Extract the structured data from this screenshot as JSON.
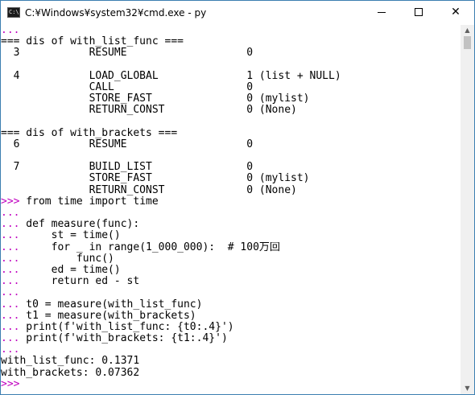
{
  "window": {
    "title": "C:¥Windows¥system32¥cmd.exe - py",
    "icon_label": "C:\\",
    "minimize_glyph": "",
    "maximize_glyph": "",
    "close_glyph": "✕",
    "colors": {
      "prompt_ps1": "#c000c0",
      "prompt_ps2": "#c000c0",
      "text": "#000000",
      "background": "#ffffff"
    }
  },
  "scrollbar": {
    "up_arrow": "▲",
    "down_arrow": "▼"
  },
  "console": {
    "lines": [
      {
        "prompt": "...",
        "text": ""
      },
      {
        "prompt": "",
        "text": "=== dis of with_list_func ==="
      },
      {
        "prompt": "",
        "text": "  3           RESUME                   0"
      },
      {
        "prompt": "",
        "text": ""
      },
      {
        "prompt": "",
        "text": "  4           LOAD_GLOBAL              1 (list + NULL)"
      },
      {
        "prompt": "",
        "text": "              CALL                     0"
      },
      {
        "prompt": "",
        "text": "              STORE_FAST               0 (mylist)"
      },
      {
        "prompt": "",
        "text": "              RETURN_CONST             0 (None)"
      },
      {
        "prompt": "",
        "text": ""
      },
      {
        "prompt": "",
        "text": "=== dis of with_brackets ==="
      },
      {
        "prompt": "",
        "text": "  6           RESUME                   0"
      },
      {
        "prompt": "",
        "text": ""
      },
      {
        "prompt": "",
        "text": "  7           BUILD_LIST               0"
      },
      {
        "prompt": "",
        "text": "              STORE_FAST               0 (mylist)"
      },
      {
        "prompt": "",
        "text": "              RETURN_CONST             0 (None)"
      },
      {
        "prompt": ">>>",
        "text": " from time import time"
      },
      {
        "prompt": "...",
        "text": ""
      },
      {
        "prompt": "...",
        "text": " def measure(func):"
      },
      {
        "prompt": "...",
        "text": "     st = time()"
      },
      {
        "prompt": "...",
        "text": "     for _ in range(1_000_000):  # 100万回"
      },
      {
        "prompt": "...",
        "text": "         func()"
      },
      {
        "prompt": "...",
        "text": "     ed = time()"
      },
      {
        "prompt": "...",
        "text": "     return ed - st"
      },
      {
        "prompt": "...",
        "text": ""
      },
      {
        "prompt": "...",
        "text": " t0 = measure(with_list_func)"
      },
      {
        "prompt": "...",
        "text": " t1 = measure(with_brackets)"
      },
      {
        "prompt": "...",
        "text": " print(f'with_list_func: {t0:.4}')"
      },
      {
        "prompt": "...",
        "text": " print(f'with_brackets: {t1:.4}')"
      },
      {
        "prompt": "...",
        "text": ""
      },
      {
        "prompt": "",
        "text": "with_list_func: 0.1371"
      },
      {
        "prompt": "",
        "text": "with_brackets: 0.07362"
      },
      {
        "prompt": ">>>",
        "text": ""
      }
    ]
  }
}
